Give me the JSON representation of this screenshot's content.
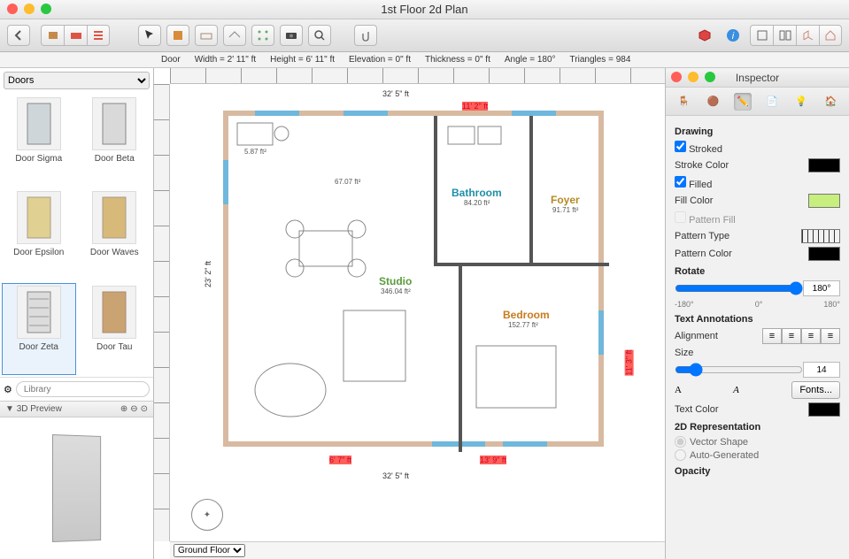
{
  "window": {
    "title": "1st Floor 2d Plan"
  },
  "status": {
    "object": "Door",
    "width_label": "Width",
    "width": "2' 11\" ft",
    "height_label": "Height",
    "height": "6' 11\" ft",
    "elevation_label": "Elevation",
    "elevation": "0\" ft",
    "thickness_label": "Thickness",
    "thickness": "0\" ft",
    "angle_label": "Angle",
    "angle": "180°",
    "triangles_label": "Triangles",
    "triangles": "984"
  },
  "library": {
    "category": "Doors",
    "items": [
      {
        "label": "Door Sigma"
      },
      {
        "label": "Door Beta"
      },
      {
        "label": "Door Epsilon"
      },
      {
        "label": "Door Waves"
      },
      {
        "label": "Door Zeta"
      },
      {
        "label": "Door Tau"
      }
    ],
    "selected_index": 4,
    "search_placeholder": "Library",
    "preview_label": "3D Preview"
  },
  "floor_select": "Ground Floor",
  "plan": {
    "dims": {
      "top_outer": "32' 5\" ft",
      "top_inner": "11' 2\" ft",
      "left_outer": "23' 2\" ft",
      "right_inner": "11' 3\" ft",
      "bottom_left": "6' 7\" ft",
      "bottom_right": "13' 9\" ft",
      "bottom_outer": "32' 5\" ft",
      "small": "5.87 ft²"
    },
    "rooms": {
      "bathroom": {
        "name": "Bathroom",
        "area": "84.20 ft²",
        "color": "#1f8fa8"
      },
      "foyer": {
        "name": "Foyer",
        "area": "91.71 ft²",
        "color": "#b78a25"
      },
      "studio": {
        "name": "Studio",
        "area": "346.04 ft²",
        "color": "#5a9b3b"
      },
      "bedroom": {
        "name": "Bedroom",
        "area": "152.77 ft²",
        "color": "#c97a1e"
      },
      "kitchen_area": "67.07 ft²"
    }
  },
  "inspector": {
    "title": "Inspector",
    "section_drawing": "Drawing",
    "stroked_label": "Stroked",
    "stroke_color_label": "Stroke Color",
    "filled_label": "Filled",
    "fill_color_label": "Fill Color",
    "pattern_fill_label": "Pattern Fill",
    "pattern_type_label": "Pattern Type",
    "pattern_color_label": "Pattern Color",
    "rotate_label": "Rotate",
    "rotate_value": "180°",
    "rotate_min": "-180°",
    "rotate_mid": "0°",
    "rotate_max": "180°",
    "section_text": "Text Annotations",
    "alignment_label": "Alignment",
    "size_label": "Size",
    "size_value": "14",
    "fonts_button": "Fonts...",
    "text_color_label": "Text Color",
    "section_2d": "2D Representation",
    "vector_label": "Vector Shape",
    "autogen_label": "Auto-Generated",
    "opacity_label": "Opacity",
    "stroked_checked": true,
    "filled_checked": true,
    "pattern_fill_checked": false
  }
}
